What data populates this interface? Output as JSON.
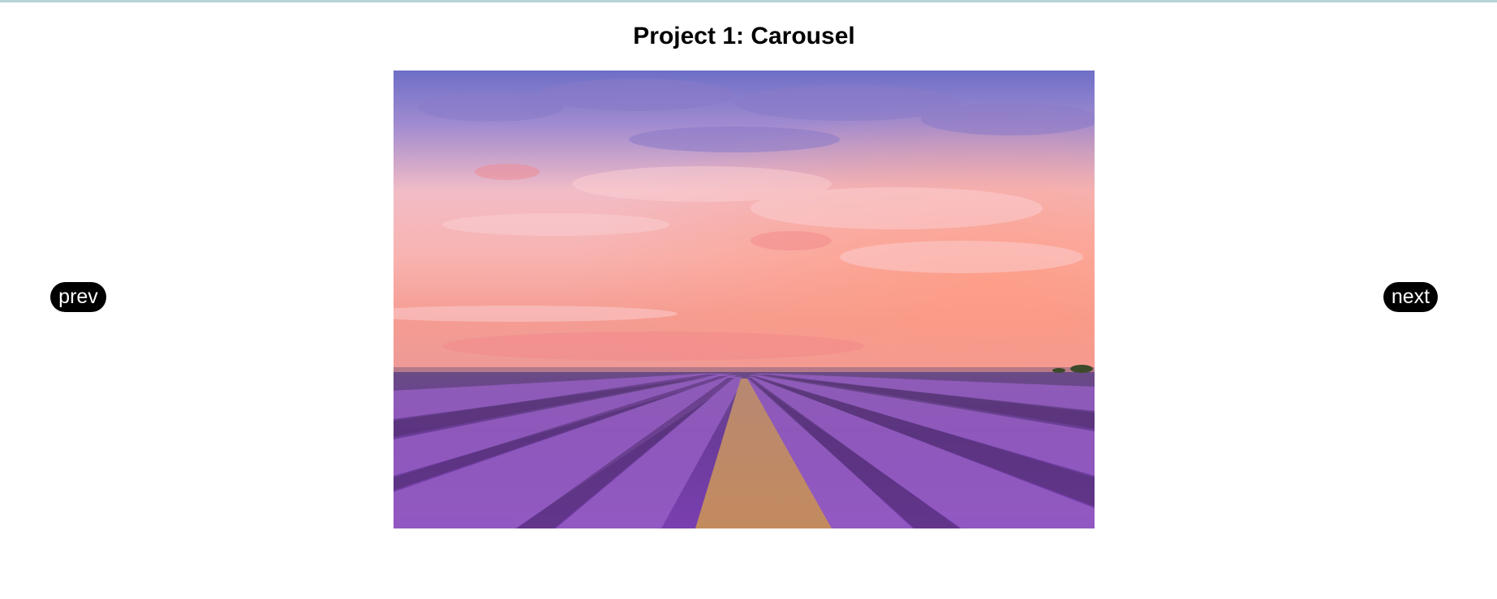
{
  "page": {
    "title": "Project 1: Carousel"
  },
  "carousel": {
    "prev_label": "prev",
    "next_label": "next",
    "current_slide": {
      "subject": "lavender-field-sunset",
      "colors": {
        "sky_top": "#6f70c8",
        "sky_mid": "#f5b6b8",
        "horizon": "#f59a8f",
        "lavender": "#7a3fa6",
        "path": "#c48a62"
      }
    }
  },
  "colors": {
    "button_bg": "#000000",
    "button_text": "#ffffff",
    "top_border": "#b7d3d8"
  }
}
